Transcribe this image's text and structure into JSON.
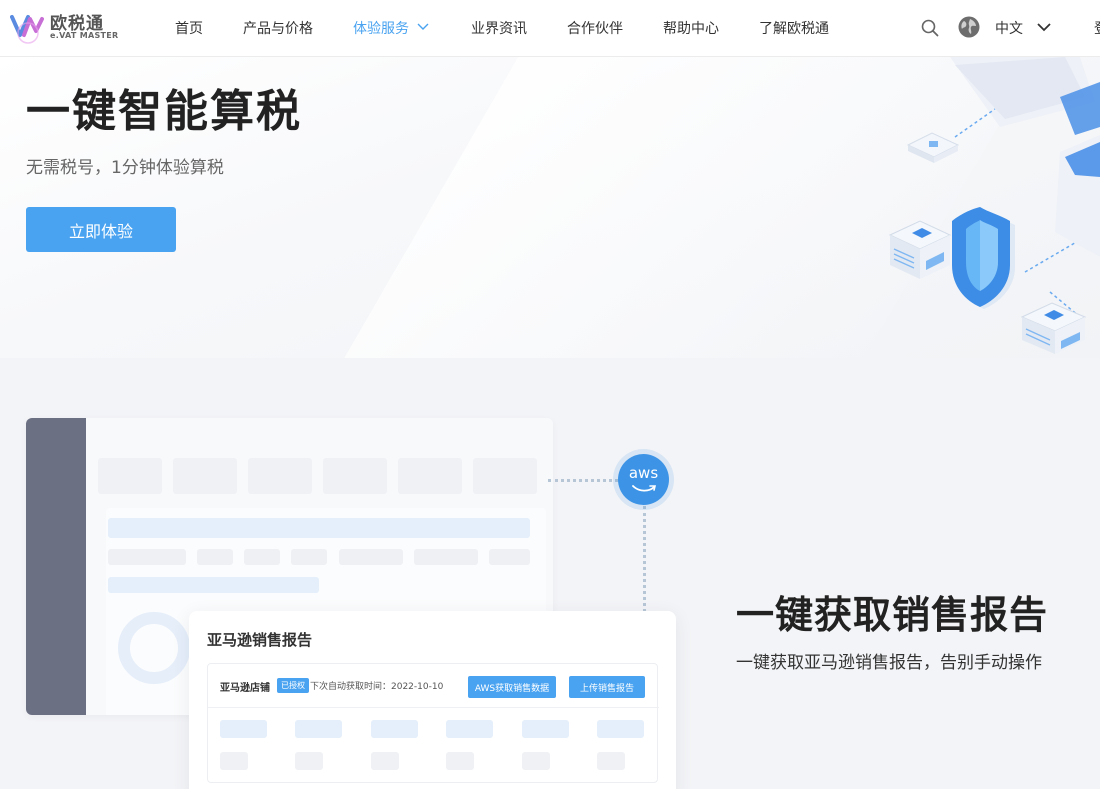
{
  "brand": {
    "name_cn": "欧税通",
    "name_en": "e.VAT MASTER"
  },
  "nav": {
    "items": [
      {
        "label": "首页"
      },
      {
        "label": "产品与价格"
      },
      {
        "label": "体验服务",
        "active": true
      },
      {
        "label": "业界资讯"
      },
      {
        "label": "合作伙伴"
      },
      {
        "label": "帮助中心"
      },
      {
        "label": "了解欧税通"
      }
    ],
    "language": "中文",
    "login": "登"
  },
  "hero": {
    "title": "一键智能算税",
    "subtitle": "无需税号，1分钟体验算税",
    "cta": "立即体验"
  },
  "feature": {
    "aws_label": "aws",
    "card_title": "亚马逊销售报告",
    "store_name": "亚马逊店铺",
    "auth_badge": "已授权",
    "next_fetch": "下次自动获取时间：2022-10-10",
    "btn_aws": "AWS获取销售数据",
    "btn_upload": "上传销售报告",
    "title": "一键获取销售报告",
    "subtitle": "一键获取亚马逊销售报告，告别手动操作"
  },
  "colors": {
    "accent": "#4aa3f0",
    "aws_blue": "#3d94e6",
    "sidebar": "#6b7083"
  }
}
